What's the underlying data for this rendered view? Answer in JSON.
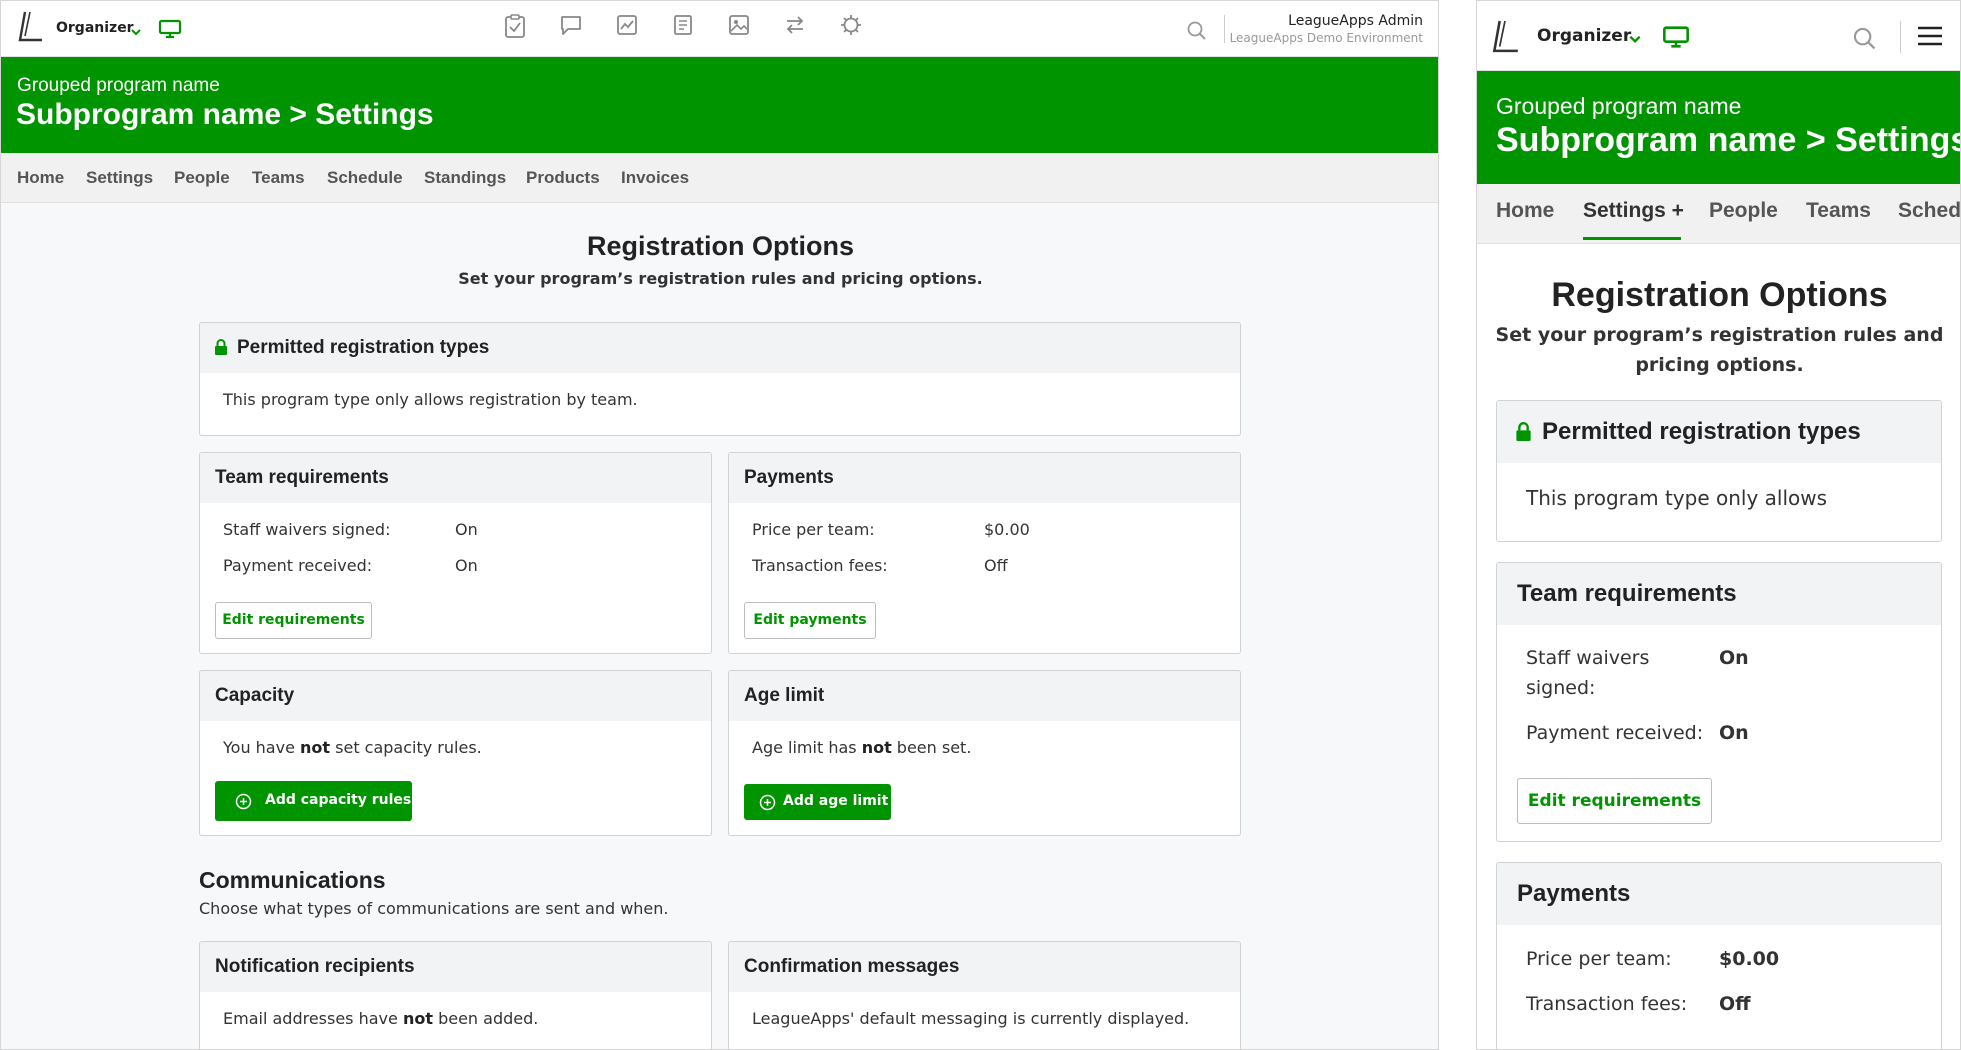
{
  "colors": {
    "brand_green": "#009400",
    "header_bg": "#ffffff",
    "nav_bg": "#f1f1f1",
    "page_bg": "#f6f8fa"
  },
  "desktop": {
    "org_label": "Organizer",
    "admin_name": "LeagueApps Admin",
    "admin_env": "LeagueApps Demo Environment",
    "toolbar_icons": [
      "clipboard-check-icon",
      "chat-icon",
      "chart-icon",
      "list-icon",
      "image-icon",
      "transfer-icon",
      "gear-icon"
    ],
    "hero": {
      "subtitle": "Grouped program name",
      "title": "Subprogram name > Settings"
    },
    "nav": [
      "Home",
      "Settings",
      "People",
      "Teams",
      "Schedule",
      "Standings",
      "Products",
      "Invoices"
    ],
    "page": {
      "title": "Registration Options",
      "subtitle": "Set your program’s registration rules and pricing options."
    },
    "permitted": {
      "title": "Permitted registration types",
      "text": "This program type only allows registration by team."
    },
    "team_req": {
      "title": "Team requirements",
      "rows": [
        {
          "label": "Staff waivers signed:",
          "value": "On"
        },
        {
          "label": "Payment received:",
          "value": "On"
        }
      ],
      "button": "Edit requirements"
    },
    "payments": {
      "title": "Payments",
      "rows": [
        {
          "label": "Price per team:",
          "value": "$0.00"
        },
        {
          "label": "Transaction fees:",
          "value": "Off"
        }
      ],
      "button": "Edit payments"
    },
    "capacity": {
      "title": "Capacity",
      "text_pre": "You have ",
      "text_bold": "not",
      "text_post": " set capacity rules.",
      "button": "Add capacity rules"
    },
    "age": {
      "title": "Age limit",
      "text_pre": "Age limit has ",
      "text_bold": "not",
      "text_post": " been set.",
      "button": "Add age limit"
    },
    "comms": {
      "title": "Communications",
      "subtitle": "Choose what types of communications are sent and when."
    },
    "notif": {
      "title": "Notification recipients",
      "text_pre": "Email addresses have ",
      "text_bold": "not",
      "text_post": " been added."
    },
    "confirm": {
      "title": "Confirmation messages",
      "text": "LeagueApps' default messaging is currently displayed."
    }
  },
  "mobile": {
    "org_label": "Organizer",
    "hero": {
      "subtitle": "Grouped program name",
      "title": "Subprogram name > Settings"
    },
    "nav": [
      "Home",
      "Settings +",
      "People",
      "Teams",
      "Sched"
    ],
    "active_nav": "Settings +",
    "page": {
      "title": "Registration Options",
      "subtitle_l1": "Set your program’s registration rules and",
      "subtitle_l2": "pricing options."
    },
    "permitted": {
      "title": "Permitted registration types",
      "text": "This program type only allows"
    },
    "team_req": {
      "title": "Team requirements",
      "row1_label_l1": "Staff waivers",
      "row1_label_l2": "signed:",
      "row1_value": "On",
      "row2_label": "Payment received:",
      "row2_value": "On",
      "button": "Edit requirements"
    },
    "payments": {
      "title": "Payments",
      "rows": [
        {
          "label": "Price per team:",
          "value": "$0.00"
        },
        {
          "label": "Transaction fees:",
          "value": "Off"
        }
      ]
    }
  }
}
